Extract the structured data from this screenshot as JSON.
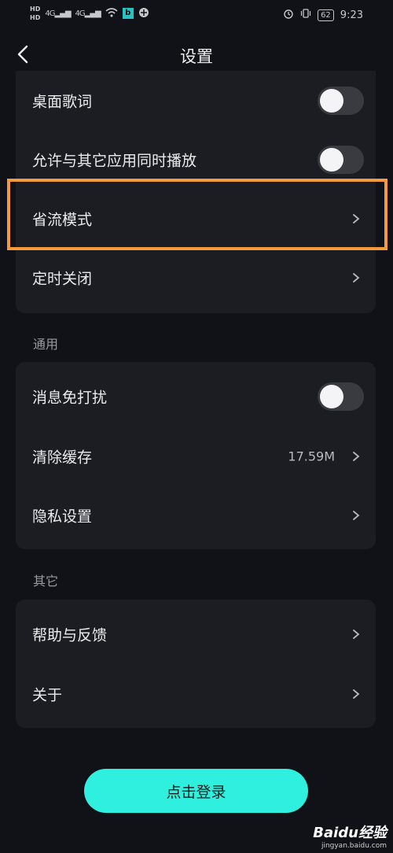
{
  "status_bar": {
    "hd1": "HD",
    "hd2": "HD",
    "signal1": "4G",
    "signal2": "4G",
    "app_badge": "b",
    "battery": "62",
    "time": "9:23"
  },
  "header": {
    "title": "设置"
  },
  "card1": {
    "items": [
      {
        "label": "桌面歌词",
        "type": "toggle",
        "on": false
      },
      {
        "label": "允许与其它应用同时播放",
        "type": "toggle",
        "on": false
      },
      {
        "label": "省流模式",
        "type": "link"
      },
      {
        "label": "定时关闭",
        "type": "link"
      }
    ]
  },
  "general": {
    "title": "通用",
    "items": [
      {
        "label": "消息免打扰",
        "type": "toggle",
        "on": false
      },
      {
        "label": "清除缓存",
        "type": "link",
        "value": "17.59M"
      },
      {
        "label": "隐私设置",
        "type": "link"
      }
    ]
  },
  "other": {
    "title": "其它",
    "items": [
      {
        "label": "帮助与反馈",
        "type": "link"
      },
      {
        "label": "关于",
        "type": "link"
      }
    ]
  },
  "login_button": {
    "label": "点击登录"
  },
  "watermark": {
    "logo": "Baidu经验",
    "url": "jingyan.baidu.com"
  },
  "colors": {
    "accent": "#2ff0df",
    "highlight": "#f39a3e",
    "background": "#111217",
    "card": "#1c1d22"
  }
}
